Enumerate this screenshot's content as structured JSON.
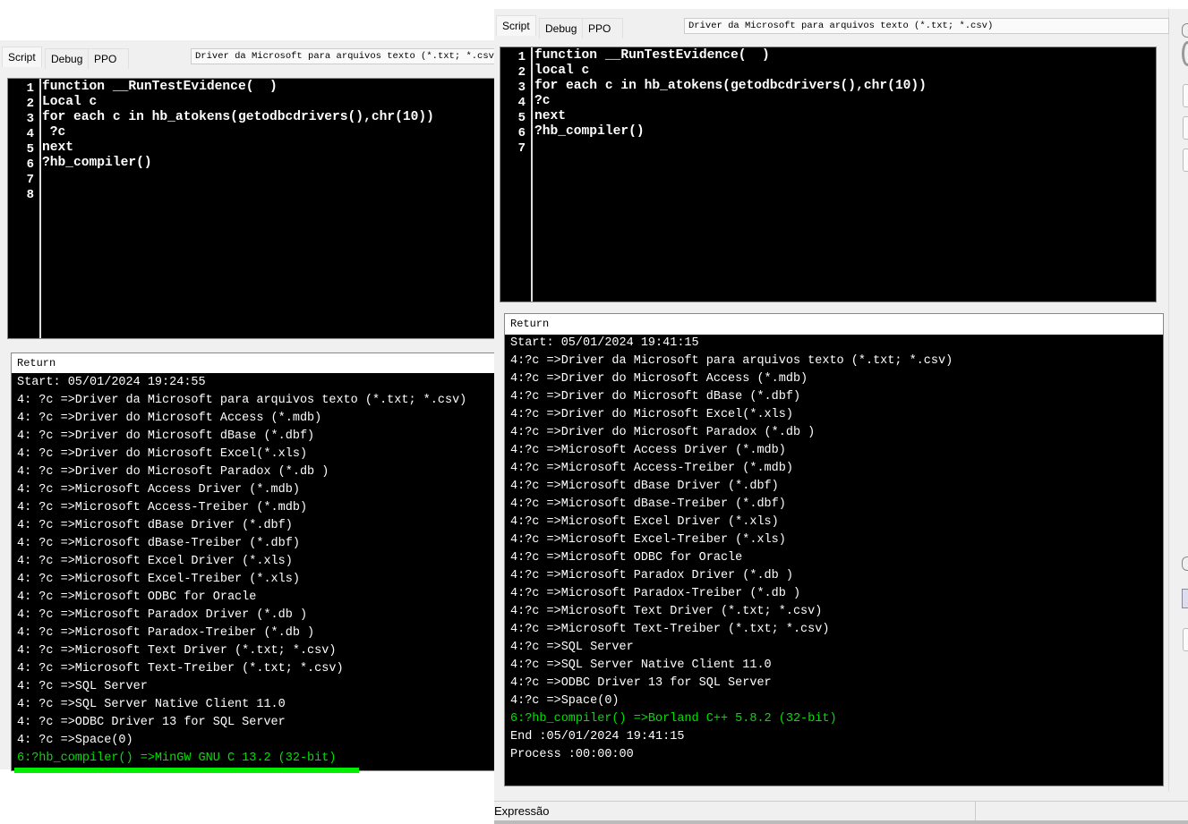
{
  "left": {
    "tabs": [
      "Script",
      "Debug",
      "PPO"
    ],
    "combo_value": "Driver da Microsoft para arquivos texto (*.txt; *.csv)",
    "line_numbers": [
      "1",
      "2",
      "3",
      "4",
      "5",
      "6",
      "7",
      "8"
    ],
    "code": [
      "function __RunTestEvidence(  )",
      "Local c",
      "for each c in hb_atokens(getodbcdrivers(),chr(10))",
      " ?c",
      "next",
      "?hb_compiler()",
      "",
      ""
    ],
    "return_label": "Return",
    "output": [
      "Start: 05/01/2024 19:24:55",
      "4: ?c =>Driver da Microsoft para arquivos texto (*.txt; *.csv)",
      "4: ?c =>Driver do Microsoft Access (*.mdb)",
      "4: ?c =>Driver do Microsoft dBase (*.dbf)",
      "4: ?c =>Driver do Microsoft Excel(*.xls)",
      "4: ?c =>Driver do Microsoft Paradox (*.db )",
      "4: ?c =>Microsoft Access Driver (*.mdb)",
      "4: ?c =>Microsoft Access-Treiber (*.mdb)",
      "4: ?c =>Microsoft dBase Driver (*.dbf)",
      "4: ?c =>Microsoft dBase-Treiber (*.dbf)",
      "4: ?c =>Microsoft Excel Driver (*.xls)",
      "4: ?c =>Microsoft Excel-Treiber (*.xls)",
      "4: ?c =>Microsoft ODBC for Oracle",
      "4: ?c =>Microsoft Paradox Driver (*.db )",
      "4: ?c =>Microsoft Paradox-Treiber (*.db )",
      "4: ?c =>Microsoft Text Driver (*.txt; *.csv)",
      "4: ?c =>Microsoft Text-Treiber (*.txt; *.csv)",
      "4: ?c =>SQL Server",
      "4: ?c =>SQL Server Native Client 11.0",
      "4: ?c =>ODBC Driver 13 for SQL Server",
      "4: ?c =>Space(0)",
      "6:?hb_compiler() =>MinGW GNU C 13.2 (32-bit)"
    ],
    "green_lines": [
      21
    ],
    "progress_color": "#00ee00"
  },
  "right": {
    "tabs": [
      "Script",
      "Debug",
      "PPO"
    ],
    "combo_value": "Driver da Microsoft para arquivos texto (*.txt; *.csv)",
    "line_numbers": [
      "1",
      "2",
      "3",
      "4",
      "5",
      "6",
      "7"
    ],
    "code": [
      "function __RunTestEvidence(  )",
      "local c",
      "for each c in hb_atokens(getodbcdrivers(),chr(10))",
      "?c",
      "next",
      "?hb_compiler()",
      ""
    ],
    "return_label": "Return",
    "output": [
      "Start: 05/01/2024 19:41:15",
      "4:?c =>Driver da Microsoft para arquivos texto (*.txt; *.csv)",
      "4:?c =>Driver do Microsoft Access (*.mdb)",
      "4:?c =>Driver do Microsoft dBase (*.dbf)",
      "4:?c =>Driver do Microsoft Excel(*.xls)",
      "4:?c =>Driver do Microsoft Paradox (*.db )",
      "4:?c =>Microsoft Access Driver (*.mdb)",
      "4:?c =>Microsoft Access-Treiber (*.mdb)",
      "4:?c =>Microsoft dBase Driver (*.dbf)",
      "4:?c =>Microsoft dBase-Treiber (*.dbf)",
      "4:?c =>Microsoft Excel Driver (*.xls)",
      "4:?c =>Microsoft Excel-Treiber (*.xls)",
      "4:?c =>Microsoft ODBC for Oracle",
      "4:?c =>Microsoft Paradox Driver (*.db )",
      "4:?c =>Microsoft Paradox-Treiber (*.db )",
      "4:?c =>Microsoft Text Driver (*.txt; *.csv)",
      "4:?c =>Microsoft Text-Treiber (*.txt; *.csv)",
      "4:?c =>SQL Server",
      "4:?c =>SQL Server Native Client 11.0",
      "4:?c =>ODBC Driver 13 for SQL Server",
      "4:?c =>Space(0)",
      "6:?hb_compiler() =>Borland C++ 5.8.2 (32-bit)",
      "End :05/01/2024 19:41:15",
      "Process :00:00:00"
    ],
    "green_lines": [
      21
    ],
    "status_label": "Expressão"
  }
}
